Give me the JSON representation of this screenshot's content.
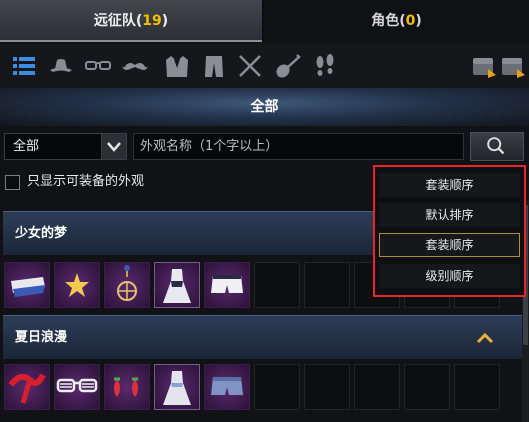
{
  "tabs": [
    {
      "label": "远征队",
      "count": "19"
    },
    {
      "label": "角色",
      "count": "0"
    }
  ],
  "categories": [
    "list-icon",
    "hat-icon",
    "glasses-icon",
    "mustache-icon",
    "suit-icon",
    "pants-icon",
    "swords-icon",
    "guitar-icon",
    "footprints-icon",
    "chest-icon",
    "chest-alt-icon"
  ],
  "banner_title": "全部",
  "filter": {
    "select_value": "全部",
    "search_placeholder": "外观名称（1个字以上）",
    "checkbox_label": "只显示可装备的外观"
  },
  "sort_menu": {
    "items": [
      "套装顺序",
      "默认排序",
      "套装顺序",
      "级别顺序"
    ],
    "selected_index": 2
  },
  "sections": [
    {
      "title": "少女的梦",
      "items": [
        "hat-icon",
        "star-icon",
        "necklace-icon",
        "dress-icon",
        "shorts-icon"
      ]
    },
    {
      "title": "夏日浪漫",
      "items": [
        "ribbon-icon",
        "shutter-glasses-icon",
        "strawberry-earrings-icon",
        "dress-icon",
        "denim-shorts-icon"
      ]
    }
  ],
  "colors": {
    "accent_gold": "#f2c100",
    "highlight_red": "#e8262a"
  }
}
